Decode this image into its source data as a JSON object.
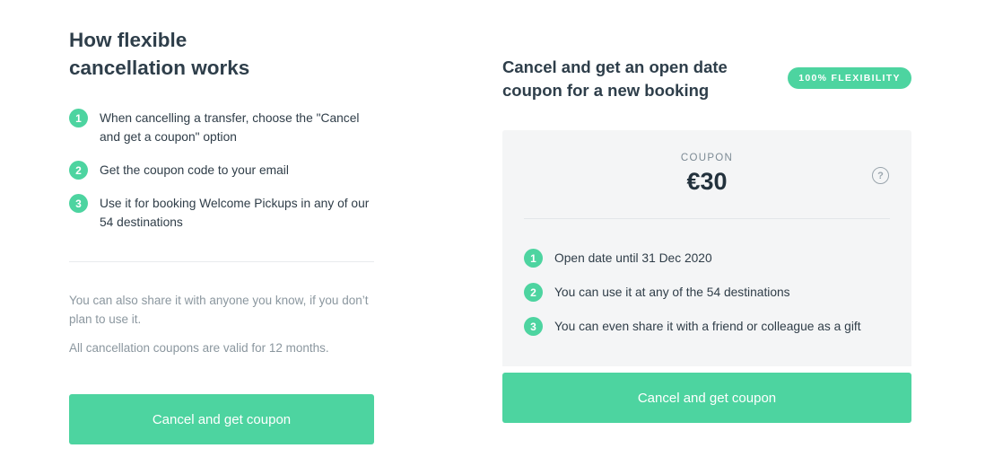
{
  "left": {
    "title": "How flexible\ncancellation works",
    "steps": [
      {
        "num": "1",
        "text": "When cancelling a transfer, choose the \"Cancel and get a coupon\" option"
      },
      {
        "num": "2",
        "text": "Get the coupon code to your email"
      },
      {
        "num": "3",
        "text": "Use it for booking Welcome Pickups in any of our 54 destinations"
      }
    ],
    "note1": "You can also share it with anyone you know, if you don’t plan to use it.",
    "note2": "All cancellation coupons are valid for 12 months.",
    "button_label": "Cancel and get coupon"
  },
  "right": {
    "title": "Cancel and get an open date coupon for a new booking",
    "badge": "100% FLEXIBILITY",
    "coupon_label": "COUPON",
    "coupon_value": "€30",
    "help_icon": "question-mark-icon",
    "steps": [
      {
        "num": "1",
        "text": "Open date until 31 Dec 2020"
      },
      {
        "num": "2",
        "text": "You can use it at any of the 54 destinations"
      },
      {
        "num": "3",
        "text": "You can even share it with a friend or colleague as a gift"
      }
    ],
    "button_label": "Cancel and get coupon"
  },
  "colors": {
    "accent": "#4dd4a0",
    "text_dark": "#2e3e4a",
    "text_muted": "#8b979f",
    "card_bg": "#f4f5f6"
  }
}
